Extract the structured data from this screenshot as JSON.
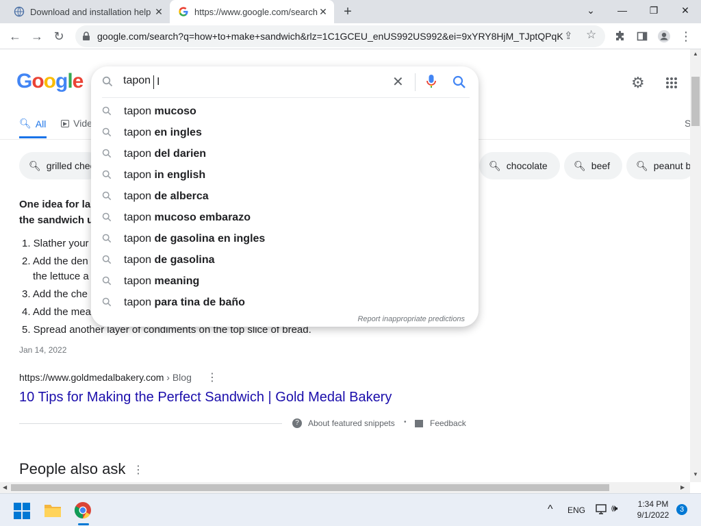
{
  "browser": {
    "tabs": [
      {
        "title": "Download and installation help"
      },
      {
        "title": "https://www.google.com/search?"
      }
    ],
    "url": "google.com/search?q=how+to+make+sandwich&rlz=1C1GCEU_enUS992US992&ei=9xYRY8HjM_TJptQPqK..."
  },
  "page": {
    "logo": "Google",
    "nav": {
      "all": "All",
      "videos": "Vide",
      "s": "S"
    },
    "chips": [
      {
        "label": "grilled chee"
      },
      {
        "label": "chocolate"
      },
      {
        "label": "beef"
      },
      {
        "label": "peanut bu"
      }
    ],
    "snippet": {
      "heading_line1": "One idea for la",
      "heading_line2": "the sandwich u",
      "steps": [
        "1. Slather your",
        "2. Add the den",
        "the lettuce a",
        "3. Add the che",
        "4. Add the mea",
        "5. Spread another layer of condiments on the top slice of bread."
      ],
      "date": "Jan 14, 2022",
      "source_url": "https://www.goldmedalbakery.com",
      "source_path": " › Blog",
      "link_title": "10 Tips for Making the Perfect Sandwich | Gold Medal Bakery",
      "about": "About featured snippets",
      "dot": "•",
      "feedback": "Feedback"
    },
    "people_also_ask": "People also ask"
  },
  "search": {
    "query": "tapon ",
    "suggestions": [
      {
        "prefix": "tapon ",
        "bold": "mucoso"
      },
      {
        "prefix": "tapon ",
        "bold": "en ingles"
      },
      {
        "prefix": "tapon ",
        "bold": "del darien"
      },
      {
        "prefix": "tapon ",
        "bold": "in english"
      },
      {
        "prefix": "tapon ",
        "bold": "de alberca"
      },
      {
        "prefix": "tapon ",
        "bold": "mucoso embarazo"
      },
      {
        "prefix": "tapon ",
        "bold": "de gasolina en ingles"
      },
      {
        "prefix": "tapon ",
        "bold": "de gasolina"
      },
      {
        "prefix": "tapon ",
        "bold": "meaning"
      },
      {
        "prefix": "tapon ",
        "bold": "para tina de baño"
      }
    ],
    "report": "Report inappropriate predictions"
  },
  "taskbar": {
    "lang": "ENG",
    "time": "1:34 PM",
    "date": "9/1/2022",
    "notifications": "3"
  }
}
